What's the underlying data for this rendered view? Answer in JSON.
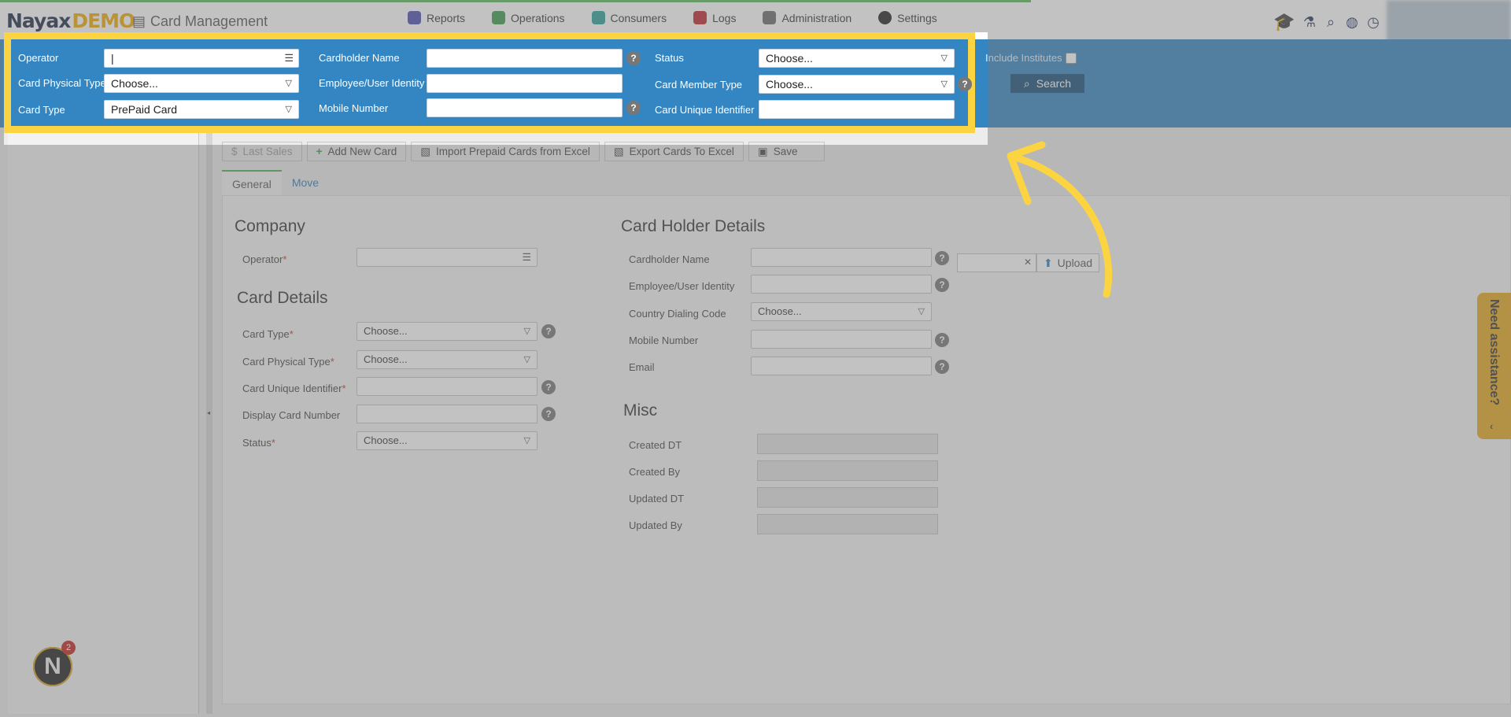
{
  "header": {
    "logo_main": "Nayax",
    "logo_demo": "DEMO",
    "module_title": "Card Management",
    "nav": [
      {
        "label": "Reports",
        "color": "#4b4fb0"
      },
      {
        "label": "Operations",
        "color": "#3a9b4a"
      },
      {
        "label": "Consumers",
        "color": "#2a9f9a"
      },
      {
        "label": "Logs",
        "color": "#c0262c"
      },
      {
        "label": "Administration",
        "color": "#6b6b6b"
      },
      {
        "label": "Settings",
        "color": "#222222"
      }
    ],
    "icons": [
      "graduation-cap-icon",
      "flask-icon",
      "search-icon",
      "globe-icon",
      "clock-icon"
    ]
  },
  "filters": {
    "operator_label": "Operator",
    "operator_value": "|",
    "card_physical_type_label": "Card Physical Type",
    "card_physical_type_value": "Choose...",
    "card_type_label": "Card Type",
    "card_type_value": "PrePaid Card",
    "cardholder_name_label": "Cardholder Name",
    "employee_identity_label": "Employee/User Identity",
    "mobile_number_label": "Mobile Number",
    "status_label": "Status",
    "status_value": "Choose...",
    "card_member_type_label": "Card Member Type",
    "card_member_type_value": "Choose...",
    "card_unique_identifier_label": "Card Unique Identifier",
    "include_institutes_label": "Include Institutes",
    "search_label": "Search"
  },
  "toolbar": {
    "last_sales": "Last Sales",
    "add_new_card": "Add New Card",
    "import_prepaid": "Import Prepaid Cards from Excel",
    "export_cards": "Export Cards To Excel",
    "save": "Save"
  },
  "tabs": [
    "General",
    "Move"
  ],
  "company": {
    "title": "Company",
    "operator_label": "Operator"
  },
  "card_details": {
    "title": "Card Details",
    "card_type_label": "Card Type",
    "card_type_value": "Choose...",
    "card_physical_type_label": "Card Physical Type",
    "card_physical_type_value": "Choose...",
    "card_unique_identifier_label": "Card Unique Identifier",
    "display_card_number_label": "Display Card Number",
    "status_label": "Status",
    "status_value": "Choose..."
  },
  "card_holder": {
    "title": "Card Holder Details",
    "cardholder_name_label": "Cardholder Name",
    "employee_identity_label": "Employee/User Identity",
    "country_dialing_code_label": "Country Dialing Code",
    "country_dialing_code_value": "Choose...",
    "mobile_number_label": "Mobile Number",
    "email_label": "Email",
    "upload_label": "Upload"
  },
  "misc": {
    "title": "Misc",
    "created_dt_label": "Created DT",
    "created_by_label": "Created By",
    "updated_dt_label": "Updated DT",
    "updated_by_label": "Updated By"
  },
  "assist": {
    "label": "Need assistance?"
  },
  "avatar": {
    "letter": "N",
    "badge_count": "2"
  },
  "colors": {
    "filter_band": "#3486c2",
    "highlight_border": "#fcd442",
    "arrow": "#fcd442",
    "accent_tab": "#4caf50"
  }
}
